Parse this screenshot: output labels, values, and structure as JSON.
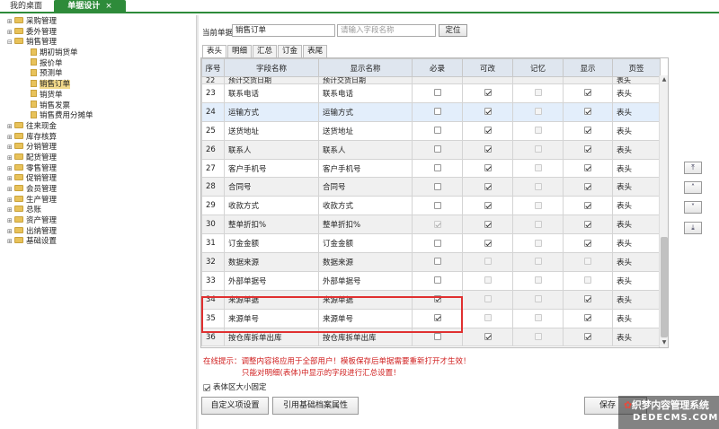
{
  "top_tabs": {
    "desktop": "我的桌面",
    "doc_design": "单据设计",
    "close": "×"
  },
  "tree": {
    "groups_before": [
      "采购管理",
      "委外管理",
      "销售管理"
    ],
    "sales_children": [
      "期初销货单",
      "报价单",
      "预测单",
      "销售订单",
      "销货单",
      "销售发票",
      "销售费用分摊单"
    ],
    "groups_after": [
      "往来现金",
      "库存核算",
      "分销管理",
      "配货管理",
      "零售管理",
      "促销管理",
      "会员管理",
      "生产管理",
      "总账",
      "资产管理",
      "出纳管理",
      "基础设置"
    ],
    "selected": "销售订单"
  },
  "form": {
    "current_doc_label": "当前单据",
    "current_doc_value": "销售订单",
    "search_placeholder": "请输入字段名称",
    "locate_button": "定位"
  },
  "sub_tabs": [
    "表头",
    "明细",
    "汇总",
    "订金",
    "表尾"
  ],
  "table": {
    "headers": [
      "序号",
      "字段名称",
      "显示名称",
      "必录",
      "可改",
      "记忆",
      "显示",
      "页签"
    ],
    "cut_row": {
      "no": "22",
      "field": "预计交货日期",
      "display": "预计交货日期",
      "page": "表头"
    },
    "rows": [
      {
        "no": "23",
        "field": "联系电话",
        "display": "联系电话",
        "req": false,
        "edit": true,
        "mem": false,
        "show": true,
        "page": "表头"
      },
      {
        "no": "24",
        "field": "运输方式",
        "display": "运输方式",
        "req": false,
        "edit": true,
        "mem": false,
        "show": true,
        "page": "表头"
      },
      {
        "no": "25",
        "field": "送货地址",
        "display": "送货地址",
        "req": false,
        "edit": true,
        "mem": false,
        "show": true,
        "page": "表头"
      },
      {
        "no": "26",
        "field": "联系人",
        "display": "联系人",
        "req": false,
        "edit": true,
        "mem": false,
        "show": true,
        "page": "表头"
      },
      {
        "no": "27",
        "field": "客户手机号",
        "display": "客户手机号",
        "req": false,
        "edit": true,
        "mem": false,
        "show": true,
        "page": "表头"
      },
      {
        "no": "28",
        "field": "合同号",
        "display": "合同号",
        "req": false,
        "edit": true,
        "mem": false,
        "show": true,
        "page": "表头"
      },
      {
        "no": "29",
        "field": "收款方式",
        "display": "收款方式",
        "req": false,
        "edit": true,
        "mem": false,
        "show": true,
        "page": "表头"
      },
      {
        "no": "30",
        "field": "整单折扣%",
        "display": "整单折扣%",
        "req": true,
        "edit": true,
        "mem": false,
        "show": true,
        "page": "表头"
      },
      {
        "no": "31",
        "field": "订金金额",
        "display": "订金金额",
        "req": false,
        "edit": true,
        "mem": false,
        "show": true,
        "page": "表头"
      },
      {
        "no": "32",
        "field": "数据来源",
        "display": "数据来源",
        "req": false,
        "edit": false,
        "mem": false,
        "show": false,
        "page": "表头"
      },
      {
        "no": "33",
        "field": "外部单据号",
        "display": "外部单据号",
        "req": false,
        "edit": false,
        "mem": false,
        "show": false,
        "page": "表头"
      },
      {
        "no": "34",
        "field": "来源单据",
        "display": "来源单据",
        "req": true,
        "edit": false,
        "mem": false,
        "show": true,
        "page": "表头"
      },
      {
        "no": "35",
        "field": "来源单号",
        "display": "来源单号",
        "req": true,
        "edit": false,
        "mem": false,
        "show": true,
        "page": "表头"
      },
      {
        "no": "36",
        "field": "按仓库拆单出库",
        "display": "按仓库拆单出库",
        "req": false,
        "edit": true,
        "mem": false,
        "show": true,
        "page": "表头"
      }
    ]
  },
  "order_buttons": [
    "⤒",
    "˄",
    "˅",
    "⤓"
  ],
  "tips": {
    "line1": "在线提示：调整内容将应用于全部用户！模板保存后单据需要重新打开才生效！",
    "line2": "只能对明细(表体)中显示的字段进行汇总设置！"
  },
  "fix_body_label": "表体区大小固定",
  "buttons": {
    "custom": "自定义项设置",
    "reference": "引用基础档案属性",
    "save": "保存"
  },
  "watermark": {
    "line1": "织梦内容管理系统",
    "line2": "DEDECMS.COM"
  }
}
